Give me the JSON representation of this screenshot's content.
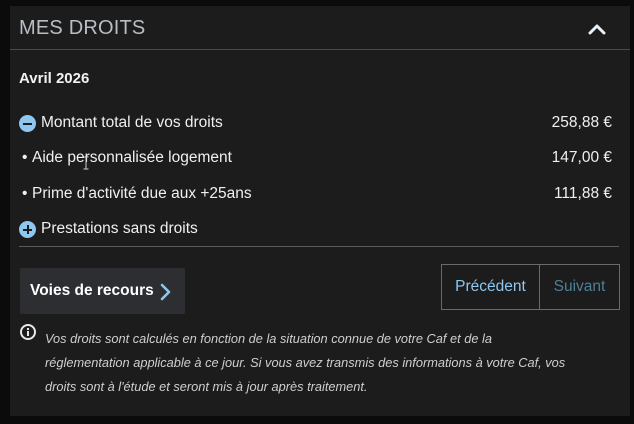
{
  "header": {
    "title": "MES DROITS"
  },
  "period": "Avril 2026",
  "rows": {
    "total": {
      "label": "Montant total de vos droits",
      "amount": "258,88 €"
    },
    "apl": {
      "bullet": "•",
      "label": "Aide personnalisée logement",
      "amount": "147,00 €"
    },
    "prime": {
      "bullet": "•",
      "label": "Prime d'activité due aux +25ans",
      "amount": "111,88 €"
    },
    "sans_droits": {
      "label": "Prestations sans droits"
    }
  },
  "buttons": {
    "recours": "Voies de recours",
    "prev": "Précédent",
    "next": "Suivant"
  },
  "note": {
    "line1": "Vos droits sont calculés en fonction de la situation connue de votre Caf et de la",
    "line2": "réglementation applicable à ce jour. Si vous avez transmis des informations à votre Caf, vos",
    "line3": "droits sont à l'étude et seront mis à jour après traitement."
  },
  "colors": {
    "accent": "#8ec7f0",
    "panel": "#1c1c1c",
    "background": "#0b0b0b"
  }
}
